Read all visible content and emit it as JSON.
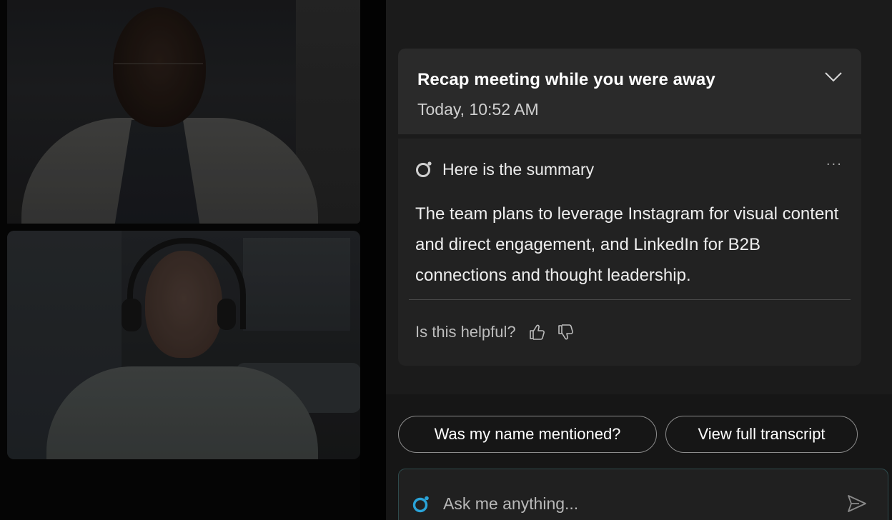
{
  "videos": {
    "top_participant": "participant-video-1",
    "bottom_participant": "participant-video-2"
  },
  "recap": {
    "title": "Recap meeting while you were away",
    "time": "Today, 10:52 AM",
    "expand_icon": "chevron-down-icon"
  },
  "summary": {
    "label": "Here is the summary",
    "more_icon": "more-horizontal-icon",
    "more_text": "···",
    "text": "The team plans to leverage Instagram for visual content and direct engagement, and LinkedIn for B2B connections and thought leadership.",
    "feedback_label": "Is this helpful?",
    "thumbs_up_icon": "thumbs-up-icon",
    "thumbs_down_icon": "thumbs-down-icon"
  },
  "suggestions": [
    {
      "label": "Was my name mentioned?"
    },
    {
      "label": "View full transcript"
    }
  ],
  "composer": {
    "placeholder": "Ask me anything...",
    "send_icon": "send-icon"
  },
  "colors": {
    "accent": "#2aa3d8",
    "panel_bg": "#1b1b1b",
    "card_bg": "#222222",
    "header_bg": "#2a2a2a"
  }
}
